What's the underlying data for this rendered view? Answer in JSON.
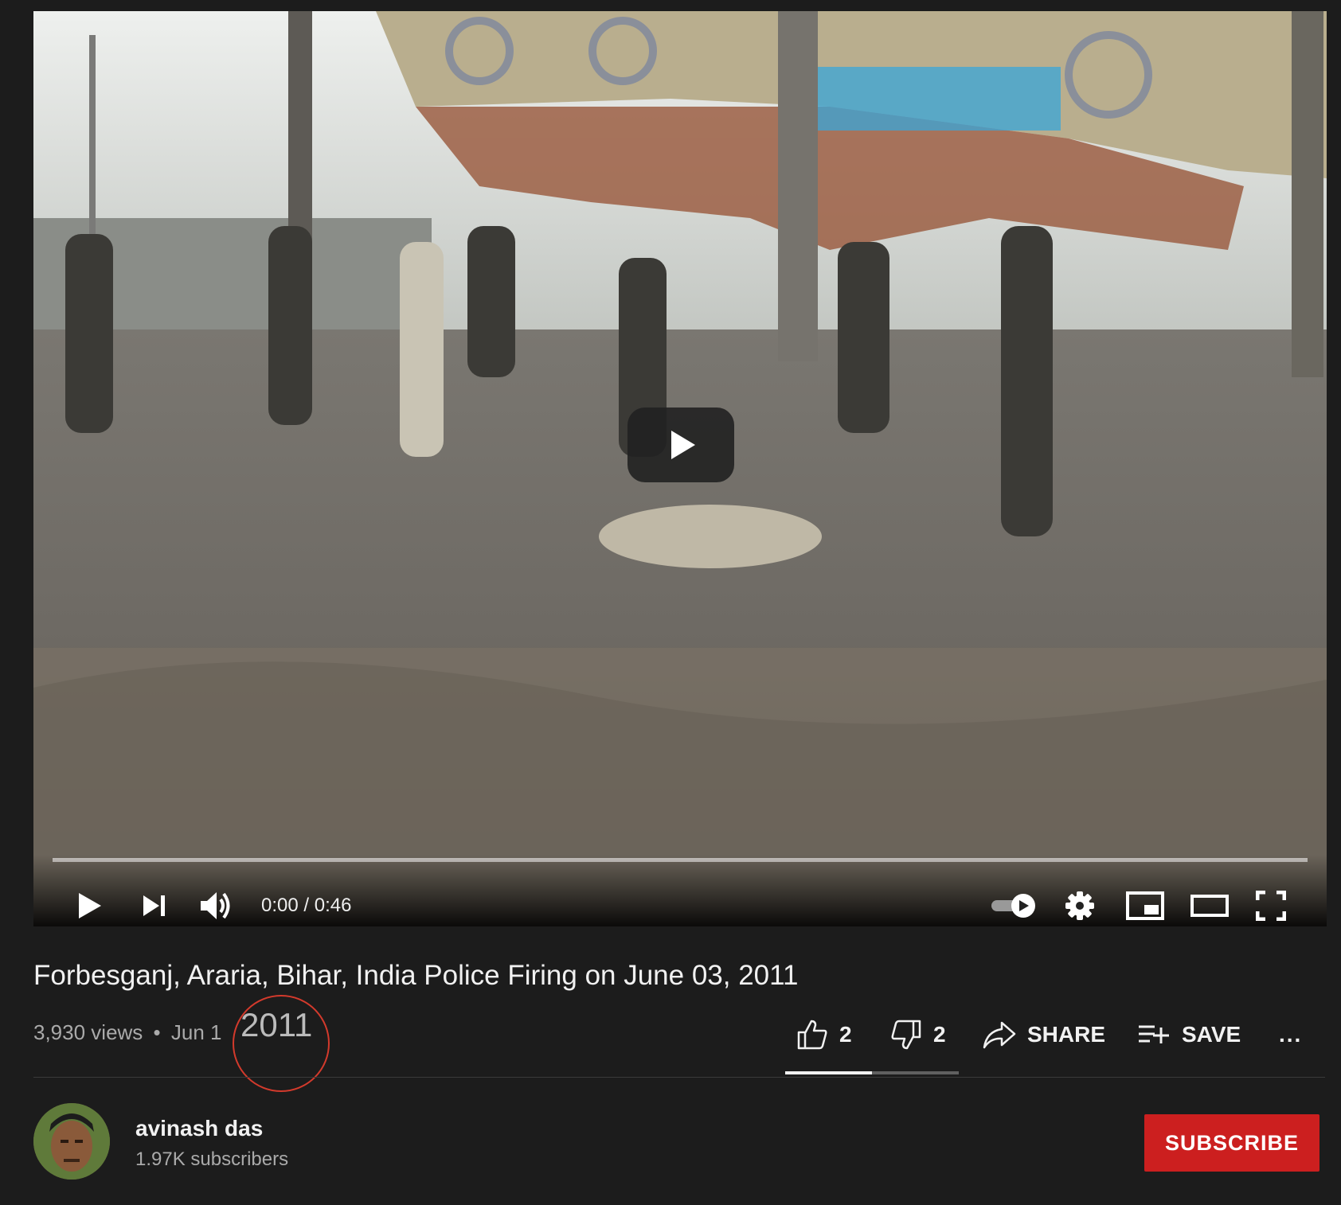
{
  "player": {
    "time_display": "0:00 / 0:46",
    "played_fraction": 0.0,
    "autoplay": "on"
  },
  "video": {
    "title": "Forbesganj, Araria, Bihar, India Police Firing on June 03, 2011",
    "views": "3,930 views",
    "separator": "•",
    "date_partial": "Jun 1",
    "year_overlay": "2011"
  },
  "actions": {
    "like_count": "2",
    "dislike_count": "2",
    "share_label": "SHARE",
    "save_label": "SAVE",
    "more_label": "..."
  },
  "sentiment": {
    "like_fraction": 0.5
  },
  "channel": {
    "name": "avinash das",
    "subscribers": "1.97K subscribers"
  },
  "subscribe_label": "SUBSCRIBE",
  "colors": {
    "background": "#1c1c1c",
    "subscribe": "#cc1f1f",
    "annotation": "#d33a2c"
  },
  "icons": [
    "play-icon",
    "next-icon",
    "volume-icon",
    "autoplay-toggle-icon",
    "settings-icon",
    "miniplayer-icon",
    "theater-icon",
    "fullscreen-icon",
    "like-icon",
    "dislike-icon",
    "share-icon",
    "save-icon",
    "more-icon"
  ]
}
